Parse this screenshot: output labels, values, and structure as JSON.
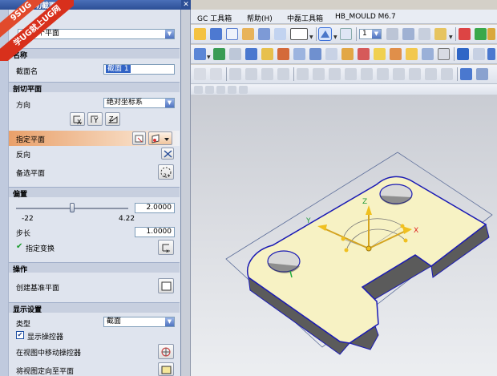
{
  "dialog": {
    "title": "剖切截面",
    "type_value": "一个平面",
    "sections": {
      "name": "名称",
      "clip_plane": "剖切平面",
      "offset": "偏置",
      "operation": "操作",
      "display": "显示设置"
    },
    "section_name_label": "截面名",
    "section_name_value": "截面 1",
    "direction_label": "方向",
    "direction_value": "绝对坐标系",
    "axis_buttons": [
      "X",
      "Y",
      "Z"
    ],
    "specify_plane_label": "指定平面",
    "reverse_label": "反向",
    "alt_plane_label": "备选平面",
    "offset_value": "2.0000",
    "slider_min": "-22",
    "slider_max": "4.22",
    "step_label": "步长",
    "step_value": "1.0000",
    "specify_transform_label": "指定变换",
    "create_datum_label": "创建基准平面",
    "type_label": "类型",
    "display_type_value": "截面",
    "show_manipulator_label": "显示操控器",
    "move_manipulator_label": "在视图中移动操控器",
    "align_view_label": "将视图定向至平面",
    "slider_fraction": 0.5
  },
  "watermark": {
    "line1": "9SUG",
    "line2": "学UG就上UG网"
  },
  "menubar": {
    "items": [
      "GC 工具箱",
      "帮助(H)",
      "中磊工具箱",
      "HB_MOULD M6.7"
    ]
  },
  "toolbar": {
    "layer_value": "1"
  },
  "triad": {
    "x": "X",
    "y": "Y",
    "z": "Z"
  },
  "colors": {
    "part_face": "#f7f2c4",
    "part_edge": "#1a1ab4",
    "title_bar": "#2c4f96",
    "highlight": "#e9a06a"
  }
}
